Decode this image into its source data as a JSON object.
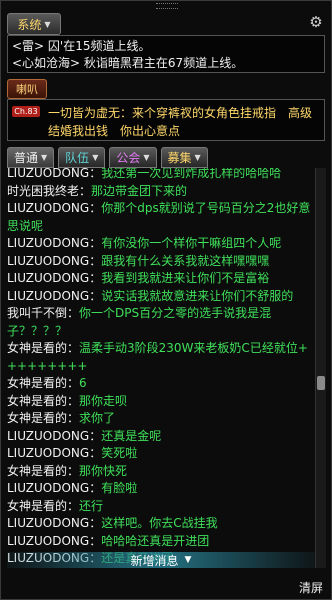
{
  "system": {
    "tab_label": "系统",
    "lines": [
      "<雷> 囚'在15频道上线。",
      "<心如沧海> 秋诣暗黑君主在67频道上线。"
    ]
  },
  "horn": {
    "tab_label": "喇叭",
    "badge": "Ch.83",
    "text": "一切皆为虚无：来个穿裤衩的女角色挂戒指　高级结婚我出钱　你出心意点"
  },
  "tabs": [
    {
      "label": "普通",
      "color": "#f0f0f0"
    },
    {
      "label": "队伍",
      "color": "#5fd2d2"
    },
    {
      "label": "公会",
      "color": "#e07af0"
    },
    {
      "label": "募集",
      "color": "#ffd76a"
    }
  ],
  "messages": [
    {
      "name": "LIUZUODONG",
      "text": "我还第一次见到炸成扎样的哈哈哈"
    },
    {
      "name": "时光困我终老",
      "text": "那边带金团下来的"
    },
    {
      "name": "LIUZUODONG",
      "text": "你那个dps就别说了号码百分之2也好意思说呢"
    },
    {
      "name": "LIUZUODONG",
      "text": "有你没你一个样你干嘛组四个人呢"
    },
    {
      "name": "LIUZUODONG",
      "text": "跟我有什么关系我就这样嘿嘿嘿"
    },
    {
      "name": "LIUZUODONG",
      "text": "我看到我就进来让你们不是富裕"
    },
    {
      "name": "LIUZUODONG",
      "text": "说实话我就故意进来让你们不舒服的"
    },
    {
      "name": "我叫千不倒",
      "text": "你一个DPS百分之零的选手说我是混子？？？？"
    },
    {
      "name": "女神是看的",
      "text": "温柔手动3阶段230W来老板奶C已经就位+++++++++"
    },
    {
      "name": "女神是看的",
      "text": "6"
    },
    {
      "name": "女神是看的",
      "text": "那你走呗"
    },
    {
      "name": "女神是看的",
      "text": "求你了"
    },
    {
      "name": "LIUZUODONG",
      "text": "还真是金呢"
    },
    {
      "name": "LIUZUODONG",
      "text": "笑死啦"
    },
    {
      "name": "女神是看的",
      "text": "那你快死"
    },
    {
      "name": "LIUZUODONG",
      "text": "有脸啦"
    },
    {
      "name": "女神是看的",
      "text": "还行"
    },
    {
      "name": "LIUZUODONG",
      "text": "这样吧。你去C战挂我"
    },
    {
      "name": "LIUZUODONG",
      "text": "哈哈哈还真是开进团"
    },
    {
      "name": "LIUZUODONG",
      "text": "还是真开进团"
    }
  ],
  "new_message_label": "新增消息",
  "clear_label": "清屏"
}
